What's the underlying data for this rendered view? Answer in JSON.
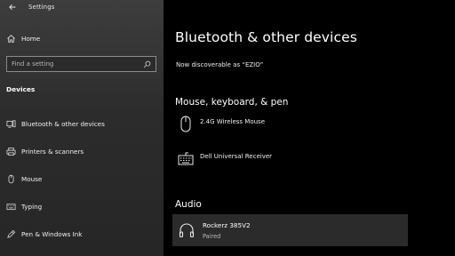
{
  "window": {
    "title": "Settings"
  },
  "sidebar": {
    "home_label": "Home",
    "search_placeholder": "Find a setting",
    "section_label": "Devices",
    "items": [
      {
        "label": "Bluetooth & other devices",
        "icon": "bluetooth-devices-icon"
      },
      {
        "label": "Printers & scanners",
        "icon": "printer-icon"
      },
      {
        "label": "Mouse",
        "icon": "mouse-icon"
      },
      {
        "label": "Typing",
        "icon": "keyboard-icon"
      },
      {
        "label": "Pen & Windows Ink",
        "icon": "pen-icon"
      }
    ]
  },
  "main": {
    "title": "Bluetooth & other devices",
    "discoverable_text": "Now discoverable as “EZIO”",
    "groups": [
      {
        "heading": "Mouse, keyboard, & pen",
        "devices": [
          {
            "name": "2.4G Wireless Mouse",
            "icon": "mouse-icon"
          },
          {
            "name": "Dell Universal Receiver",
            "icon": "keyboard-icon"
          }
        ]
      },
      {
        "heading": "Audio",
        "devices": [
          {
            "name": "Rockerz 385V2",
            "status": "Paired",
            "icon": "headphones-icon"
          }
        ]
      }
    ]
  }
}
